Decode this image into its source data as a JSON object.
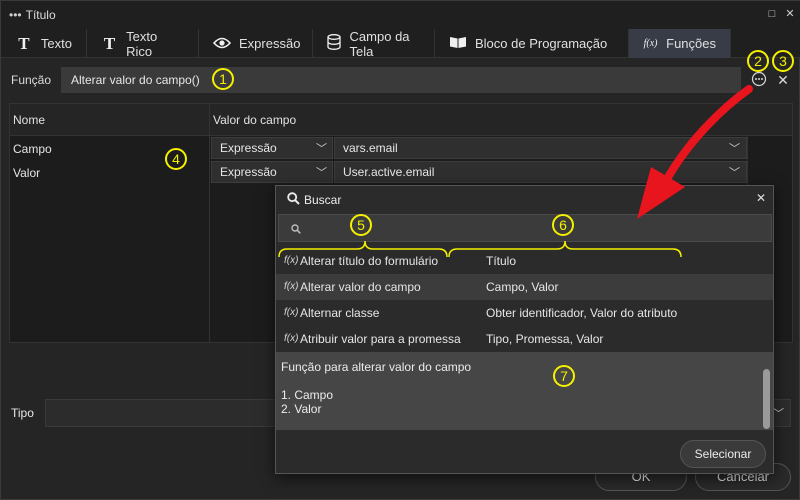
{
  "window": {
    "title": "Título",
    "title_icon": "ellipsis-icon",
    "controls": {
      "maximize_icon": "□",
      "close_icon": "✕"
    }
  },
  "tabs": [
    {
      "label": "Texto",
      "icon": "T",
      "active": false
    },
    {
      "label": "Texto Rico",
      "icon": "T",
      "active": false
    },
    {
      "label": "Expressão",
      "icon": "◉",
      "active": false
    },
    {
      "label": "Campo da Tela",
      "icon": "≡",
      "active": false
    },
    {
      "label": "Bloco de Programação",
      "icon": "▬",
      "active": false
    },
    {
      "label": "Funções",
      "icon": "f(x)",
      "active": true
    }
  ],
  "funcao": {
    "label": "Função",
    "value": "Alterar valor do campo()",
    "more_icon": "⋯",
    "clear_icon": "✕"
  },
  "grid": {
    "headers": {
      "nome": "Nome",
      "valor": "Valor do campo"
    },
    "rows": [
      {
        "name": "Campo",
        "type": "Expressão",
        "value": "vars.email"
      },
      {
        "name": "Valor",
        "type": "Expressão",
        "value": "User.active.email"
      }
    ]
  },
  "tipo": {
    "label": "Tipo"
  },
  "buttons": {
    "ok": "OK",
    "cancel": "Cancelar"
  },
  "popup": {
    "title": "Buscar",
    "search_placeholder": "",
    "items": [
      {
        "name": "Alterar título do formulário",
        "params": "Título",
        "selected": false
      },
      {
        "name": "Alterar valor do campo",
        "params": "Campo, Valor",
        "selected": true
      },
      {
        "name": "Alternar classe",
        "params": "Obter identificador, Valor do atributo",
        "selected": false
      },
      {
        "name": "Atribuir valor para a promessa",
        "params": "Tipo, Promessa, Valor",
        "selected": false
      }
    ],
    "description": {
      "summary": "Função para alterar valor do campo",
      "param1": "1. Campo",
      "param2": "2. Valor"
    },
    "select_button": "Selecionar"
  },
  "annotations": {
    "a1": "1",
    "a2": "2",
    "a3": "3",
    "a4": "4",
    "a5": "5",
    "a6": "6",
    "a7": "7"
  },
  "colors": {
    "accent_annotation": "#f5f000",
    "arrow": "#e8141e",
    "active_tab": "#373c46"
  }
}
